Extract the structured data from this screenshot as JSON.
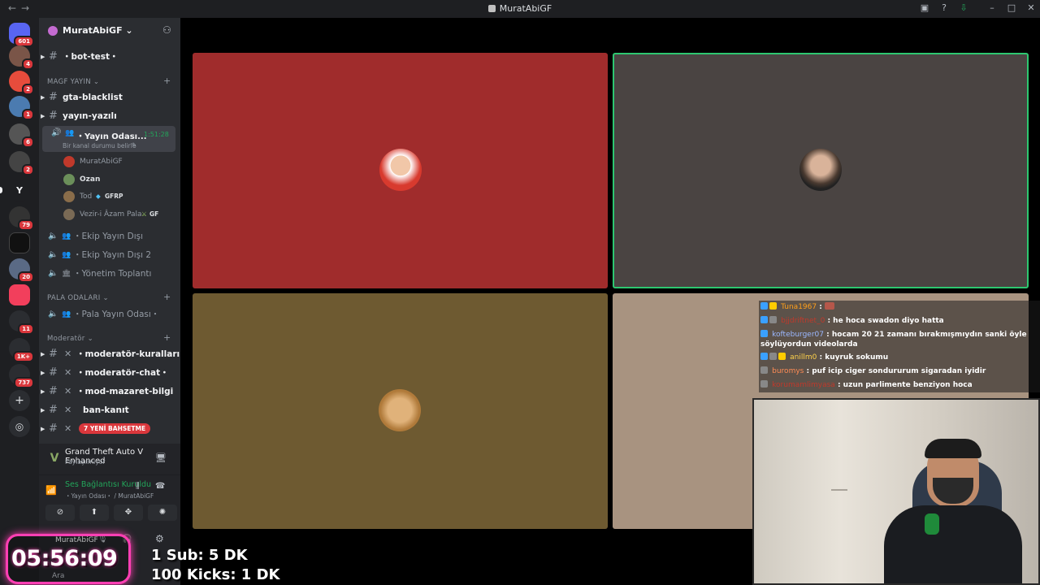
{
  "window": {
    "title": "MuratAbiGF",
    "back": "←",
    "forward": "→"
  },
  "rail": {
    "badges": [
      "601",
      "4",
      "2",
      "1",
      "6",
      "2",
      "79",
      "20",
      "11",
      "1K+",
      "737"
    ],
    "letter_y": "Y"
  },
  "guild": {
    "name": "MuratAbiGF"
  },
  "channels": {
    "bot_test": "・bot-test・",
    "cat_magf": "MAGF YAYIN",
    "gta_blacklist": "gta-blacklist",
    "yayin_yazili": "yayın-yazılı",
    "voice_active": {
      "name": "・Yayın Odası...",
      "time": "1:51:28",
      "status": "Bir kanal durumu belirle"
    },
    "members": [
      {
        "name": "MuratAbiGF",
        "tag": ""
      },
      {
        "name": "Ozan",
        "tag": ""
      },
      {
        "name": "Tod",
        "tag": "GFRP"
      },
      {
        "name": "Vezir-i Âzam Pala",
        "tag": "GF"
      }
    ],
    "voice_ekip": "・Ekip Yayın Dışı",
    "voice_ekip2": "・Ekip Yayın Dışı 2",
    "voice_yonetim": "・Yönetim Toplantı",
    "cat_pala": "PALA ODALARI",
    "voice_pala": "・Pala Yayın Odası・",
    "cat_mod": "Moderatör",
    "mod_kurallari": "・moderatör-kuralları",
    "mod_chat": "・moderatör-chat・",
    "mod_mazaret": "・mod-mazaret-bilgi",
    "ban_kanit": "ban-kanıt",
    "new_pill": "7 YENİ BAHSETME"
  },
  "activity": {
    "game": "Grand Theft Auto V Enhanced",
    "sub": "Paylaşılmıyor"
  },
  "voice_connection": {
    "status": "Ses Bağlantısı Kuruldu",
    "channel": "・Yayın Odası・ / MuratAbiGF"
  },
  "userbar": {
    "name": "MuratAbiGF",
    "search": "Ara"
  },
  "chat": [
    {
      "user": "Tuna1967",
      "user_color": "#ff9f1a",
      "msg": ":"
    },
    {
      "user": "bjjdriftnet_0",
      "user_color": "#c0392b",
      "msg": ": he hoca swadon diyo hatta"
    },
    {
      "user": "kofteburger07",
      "user_color": "#9bb8ff",
      "msg": ": hocam 20 21 zamanı bırakmışmıydın sanki öyle söylüyordun videolarda"
    },
    {
      "user": "anillm0",
      "user_color": "#ffd24a",
      "msg": ": kuyruk sokumu"
    },
    {
      "user": "buromys",
      "user_color": "#ff8c55",
      "msg": ": puf icip ciger sondururum sigaradan iyidir"
    },
    {
      "user": "korumamlimyasa",
      "user_color": "#c0392b",
      "msg": ": uzun parlimente benziyon hoca"
    }
  ],
  "overlay": {
    "timer": "05:56:09",
    "sub_goal": "1 Sub: 5 DK",
    "kick_goal": "100 Kicks: 1 DK",
    "frame_color": "#ff3fb4"
  },
  "tiles": {
    "colors": [
      "#a02c2c",
      "#4a4442",
      "#6e5a31",
      "#a89380"
    ],
    "speaking_border": "#2dc770"
  }
}
